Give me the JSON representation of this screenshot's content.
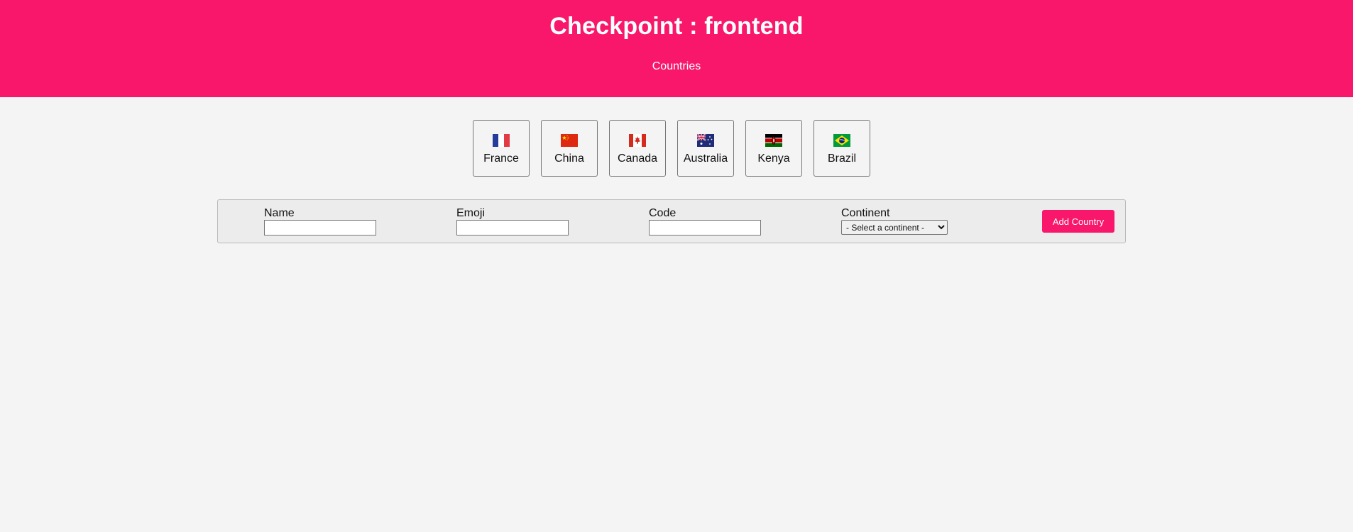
{
  "header": {
    "title": "Checkpoint : frontend",
    "subtitle": "Countries",
    "background_color": "#f8176b"
  },
  "countries": [
    {
      "name": "France",
      "flag_icon": "france-flag-icon"
    },
    {
      "name": "China",
      "flag_icon": "china-flag-icon"
    },
    {
      "name": "Canada",
      "flag_icon": "canada-flag-icon"
    },
    {
      "name": "Australia",
      "flag_icon": "australia-flag-icon"
    },
    {
      "name": "Kenya",
      "flag_icon": "kenya-flag-icon"
    },
    {
      "name": "Brazil",
      "flag_icon": "brazil-flag-icon"
    }
  ],
  "form": {
    "name_label": "Name",
    "name_value": "",
    "emoji_label": "Emoji",
    "emoji_value": "",
    "code_label": "Code",
    "code_value": "",
    "continent_label": "Continent",
    "continent_selected": "- Select a continent -",
    "submit_label": "Add Country",
    "accent_color": "#f8176b"
  }
}
